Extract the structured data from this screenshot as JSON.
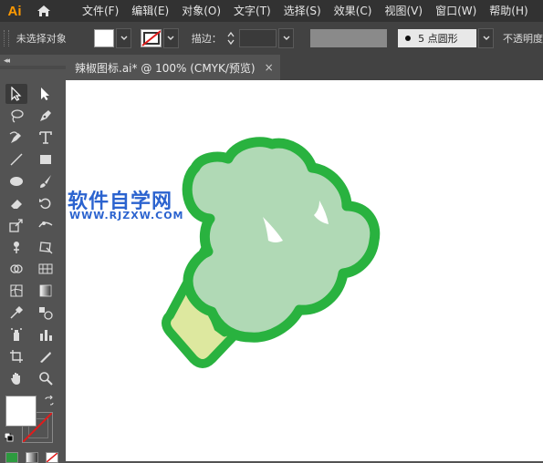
{
  "app": {
    "logo_text": "Ai"
  },
  "menu": [
    {
      "label": "文件(F)"
    },
    {
      "label": "编辑(E)"
    },
    {
      "label": "对象(O)"
    },
    {
      "label": "文字(T)"
    },
    {
      "label": "选择(S)"
    },
    {
      "label": "效果(C)"
    },
    {
      "label": "视图(V)"
    },
    {
      "label": "窗口(W)"
    },
    {
      "label": "帮助(H)"
    }
  ],
  "controlbar": {
    "selection_label": "未选择对象",
    "stroke_label": "描边：",
    "stroke_weight": "",
    "brush_label": "5 点圆形",
    "opacity_label": "不透明度"
  },
  "document_tab": {
    "title": "辣椒图标.ai* @ 100% (CMYK/预览)",
    "close_glyph": "×"
  },
  "toolbar": {
    "collapse_glyph": "◂◂"
  },
  "watermark": {
    "title": "软件自学网",
    "url": "WWW.RJZXW.COM"
  },
  "colors": {
    "broccoli_outline": "#29b23f",
    "broccoli_head": "#b0d9b5",
    "broccoli_stem": "#dde89f",
    "watermark_blue": "#2b63cf",
    "app_logo_orange": "#ff9a00",
    "canvas_bg": "#ffffff",
    "ui_panel": "#535353",
    "menubar": "#323232"
  },
  "icons": [
    "home-icon",
    "selection-tool-icon",
    "direct-selection-tool-icon",
    "lasso-tool-icon",
    "pen-tool-icon",
    "curvature-tool-icon",
    "type-tool-icon",
    "line-tool-icon",
    "rectangle-tool-icon",
    "ellipse-tool-icon",
    "paintbrush-tool-icon",
    "eraser-tool-icon",
    "rotate-tool-icon",
    "scale-tool-icon",
    "width-tool-icon",
    "puppet-warp-tool-icon",
    "free-transform-tool-icon",
    "shape-builder-tool-icon",
    "perspective-grid-tool-icon",
    "mesh-tool-icon",
    "gradient-tool-icon",
    "eyedropper-tool-icon",
    "blend-tool-icon",
    "symbol-sprayer-tool-icon",
    "column-graph-tool-icon",
    "artboard-tool-icon",
    "slice-tool-icon",
    "hand-tool-icon",
    "zoom-tool-icon"
  ]
}
